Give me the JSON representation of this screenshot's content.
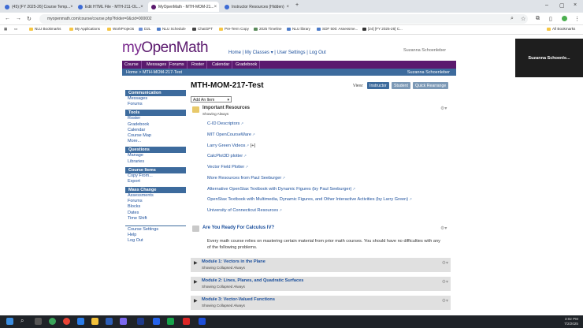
{
  "browser": {
    "tabs": [
      {
        "label": "(45) [FY 2025-26] Course Temp...",
        "color": "#3d6bd4"
      },
      {
        "label": "Edit HTML File - MTH-211-OL...",
        "color": "#3d6bd4"
      },
      {
        "label": "MyOpenMath - MTH-MOM-21...",
        "color": "#5b1a6e"
      },
      {
        "label": "Instructor Resources (Hidden)",
        "color": "#3d6bd4"
      }
    ],
    "new_tab": "+",
    "url": "myopenmath.com/course/course.php?folder=0&cid=000002",
    "bookmarks": [
      "NLU Bookmarks",
      "My Applications",
      "WorkProjects",
      "D2L",
      "NLU Schedule",
      "ChatGPT",
      "Pre-Term Copy",
      "2025 Timeline",
      "NLU library",
      "SDF 500: Assessme...",
      "[24] [FY 2025-26] C..."
    ],
    "all_bookmarks": "All Bookmarks"
  },
  "site": {
    "logo_my": "my",
    "logo_rest": "OpenMath",
    "top_links": [
      "Home",
      "My Classes ▾",
      "User Settings",
      "Log Out"
    ],
    "username": "Suzanna Schoenleber",
    "nav_tabs": [
      "Course",
      "Messages",
      "Forums",
      "Roster",
      "Calendar",
      "Gradebook"
    ],
    "breadcrumb": "Home > MTH-MOM-217-Test",
    "crumb_user": "Suzanna Schoenleber"
  },
  "sidebar": {
    "sections": [
      {
        "title": "Communication",
        "items": [
          "Messages",
          "Forums"
        ]
      },
      {
        "title": "Tools",
        "items": [
          "Roster",
          "Gradebook",
          "Calendar",
          "Course Map",
          "More..."
        ]
      },
      {
        "title": "Questions",
        "items": [
          "Manage",
          "Libraries"
        ]
      },
      {
        "title": "Course Items",
        "items": [
          "Copy From...",
          "Export"
        ]
      },
      {
        "title": "Mass Change",
        "items": [
          "Assessments",
          "Forums",
          "Blocks",
          "Dates",
          "Time Shift"
        ]
      },
      {
        "title": "",
        "items": [
          "Course Settings",
          "Help",
          "Log Out"
        ]
      }
    ]
  },
  "main": {
    "course_title": "MTH-MOM-217-Test",
    "view_label": "View:",
    "view_buttons": [
      "Instructor",
      "Student",
      "Quick Rearrange"
    ],
    "add_item": "Add An Item",
    "important": {
      "title": "Important Resources",
      "sub": "Showing Always",
      "links": [
        "C-ID Descriptors",
        "MIT OpenCourseWare",
        "Larry Green Videos",
        "CalcPlot3D plotter",
        "Vector Field Plotter",
        "More Resources from Paul Seeburger",
        "Alternative OpenStax Textbook with Dynamic Figures (by Paul Seeburger)",
        "OpenStax Textbook with Multimedia, Dynamic Figures, and Other Interactive Activities (by Larry Green)",
        "University of Connecticut Resources"
      ],
      "extra": "[+]"
    },
    "calculus": {
      "title": "Are You Ready For Calculus IV?",
      "text": "Every math course relies on mastering certain material from prior math courses.  You should have no difficulties with any of the following problems."
    },
    "modules": [
      {
        "title": "Module 1: Vectors in the Plane",
        "sub": "Showing Collapsed Always"
      },
      {
        "title": "Module 2: Lines, Planes, and Quadratic Surfaces",
        "sub": "Showing Collapsed Always"
      },
      {
        "title": "Module 3: Vector-Valued Functions",
        "sub": "Showing Collapsed Always"
      }
    ]
  },
  "overlay": {
    "name": "Suzanna Schoenle..."
  },
  "taskbar": {
    "time": "3:02 PM",
    "date": "7/2/2025"
  }
}
